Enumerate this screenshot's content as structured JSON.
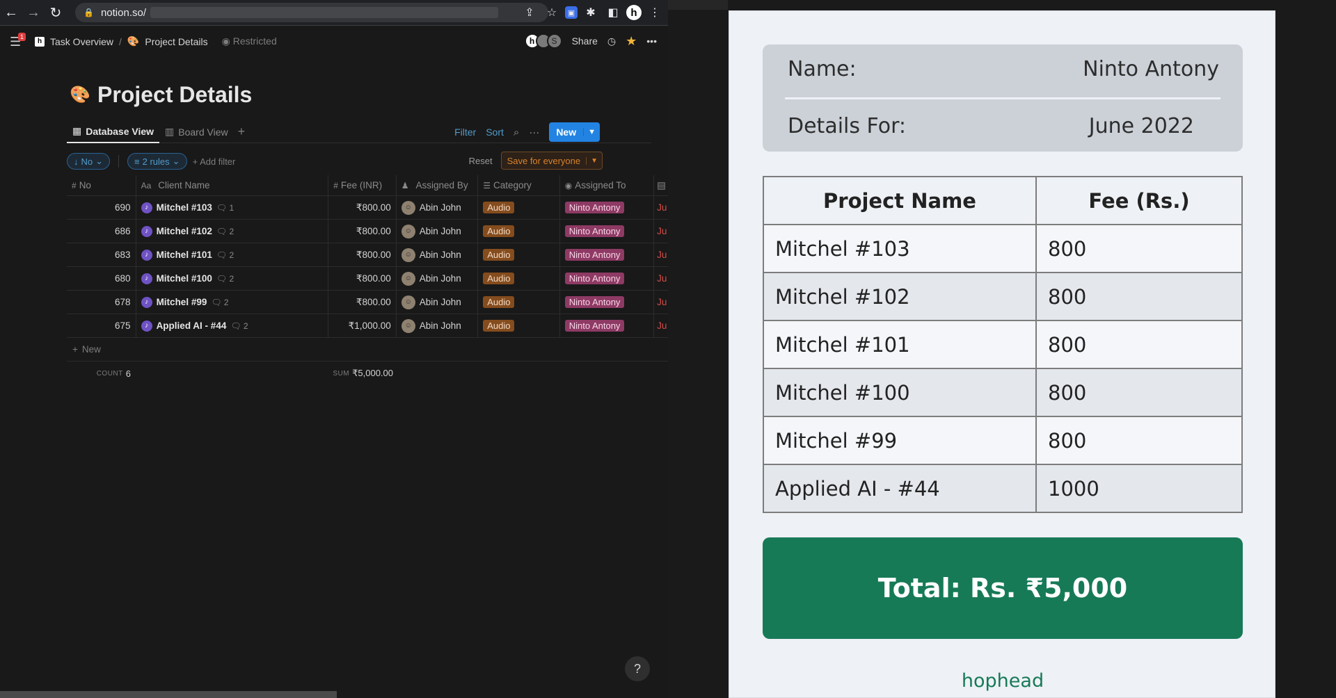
{
  "browser": {
    "url": "notion.so/"
  },
  "notion": {
    "notification_count": "1",
    "breadcrumb": [
      {
        "icon": "h",
        "label": "Task Overview"
      },
      {
        "icon": "🎨",
        "label": "Project Details"
      }
    ],
    "restricted_label": "Restricted",
    "avatars": [
      "h",
      "",
      "S"
    ],
    "share_label": "Share",
    "page_emoji": "🎨",
    "page_title": "Project Details",
    "views": [
      {
        "label": "Database View",
        "active": true
      },
      {
        "label": "Board View",
        "active": false
      }
    ],
    "view_actions": {
      "filter": "Filter",
      "sort": "Sort",
      "new": "New"
    },
    "filter_bar": {
      "sort_pill": "No",
      "rules_pill": "2 rules",
      "add_filter": "Add filter",
      "reset": "Reset",
      "save": "Save for everyone"
    },
    "columns": {
      "no": "No",
      "client": "Client Name",
      "fee": "Fee (INR)",
      "by": "Assigned By",
      "category": "Category",
      "to": "Assigned To"
    },
    "rows": [
      {
        "no": "690",
        "client": "Mitchel #103",
        "comments": "1",
        "fee": "₹800.00",
        "by": "Abin John",
        "category": "Audio",
        "to": "Ninto Antony",
        "date": "Ju"
      },
      {
        "no": "686",
        "client": "Mitchel #102",
        "comments": "2",
        "fee": "₹800.00",
        "by": "Abin John",
        "category": "Audio",
        "to": "Ninto Antony",
        "date": "Ju"
      },
      {
        "no": "683",
        "client": "Mitchel #101",
        "comments": "2",
        "fee": "₹800.00",
        "by": "Abin John",
        "category": "Audio",
        "to": "Ninto Antony",
        "date": "Ju"
      },
      {
        "no": "680",
        "client": "Mitchel #100",
        "comments": "2",
        "fee": "₹800.00",
        "by": "Abin John",
        "category": "Audio",
        "to": "Ninto Antony",
        "date": "Ju"
      },
      {
        "no": "678",
        "client": "Mitchel #99",
        "comments": "2",
        "fee": "₹800.00",
        "by": "Abin John",
        "category": "Audio",
        "to": "Ninto Antony",
        "date": "Ju"
      },
      {
        "no": "675",
        "client": "Applied AI - #44",
        "comments": "2",
        "fee": "₹1,000.00",
        "by": "Abin John",
        "category": "Audio",
        "to": "Ninto Antony",
        "date": "Ju"
      }
    ],
    "new_row": "New",
    "count_label": "COUNT",
    "count_value": "6",
    "sum_label": "SUM",
    "sum_value": "₹5,000.00",
    "help": "?"
  },
  "invoice": {
    "name_label": "Name:",
    "name_value": "Ninto Antony",
    "details_label": "Details For:",
    "details_value": "June 2022",
    "header_project": "Project Name",
    "header_fee": "Fee (Rs.)",
    "items": [
      {
        "project": "Mitchel #103",
        "fee": "800"
      },
      {
        "project": "Mitchel #102",
        "fee": "800"
      },
      {
        "project": "Mitchel #101",
        "fee": "800"
      },
      {
        "project": "Mitchel #100",
        "fee": "800"
      },
      {
        "project": "Mitchel #99",
        "fee": "800"
      },
      {
        "project": "Applied AI - #44",
        "fee": "1000"
      }
    ],
    "total": "Total: Rs. ₹5,000",
    "brand": "hophead"
  },
  "colors": {
    "accent_blue": "#2383e2",
    "total_green": "#177a57",
    "tag_audio": "#854c1d",
    "tag_person": "#8e3a64"
  }
}
